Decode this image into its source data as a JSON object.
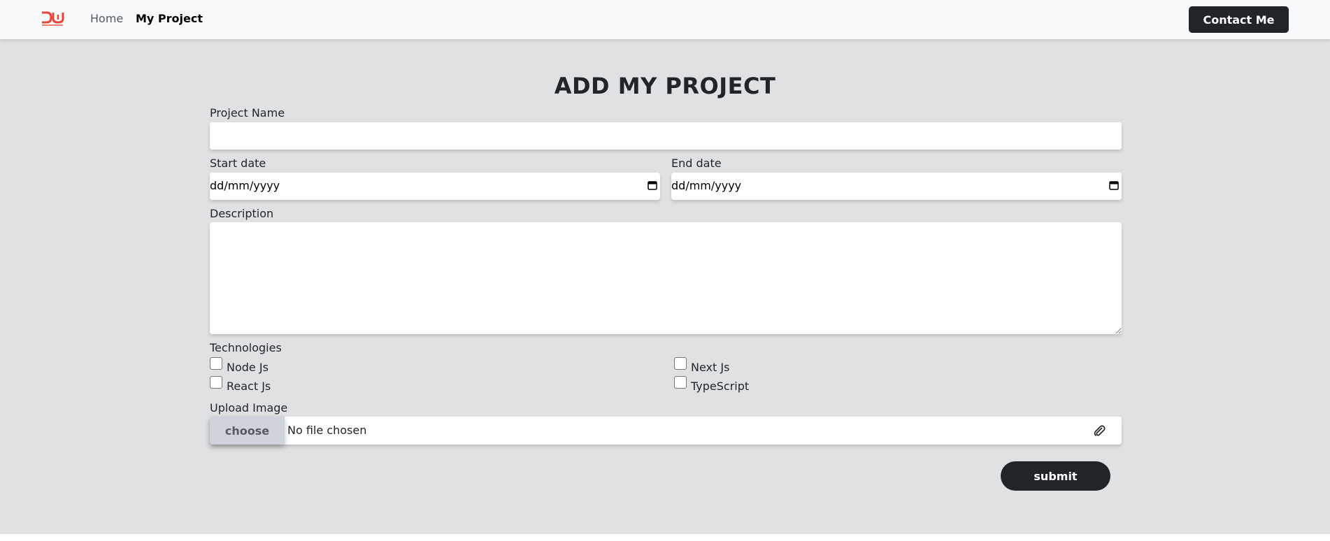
{
  "navbar": {
    "home_label": "Home",
    "project_label": "My Project",
    "contact_label": "Contact Me",
    "logo_icon": "dw-logo-icon",
    "logo_color": "#e8463a"
  },
  "form": {
    "title": "ADD MY PROJECT",
    "project_name_label": "Project Name",
    "project_name_value": "",
    "start_date_label": "Start date",
    "start_date_value": "dd/mm/yyyy",
    "end_date_label": "End date",
    "end_date_value": "dd/mm/yyyy",
    "description_label": "Description",
    "description_value": "",
    "technologies_label": "Technologies",
    "technologies": [
      {
        "label": "Node Js",
        "checked": false
      },
      {
        "label": "Next Js",
        "checked": false
      },
      {
        "label": "React Js",
        "checked": false
      },
      {
        "label": "TypeScript",
        "checked": false
      }
    ],
    "upload_label": "Upload Image",
    "choose_label": "choose",
    "file_status": "No file chosen",
    "submit_label": "submit"
  },
  "colors": {
    "background": "#e0e1e3",
    "navbar": "#f8f9fa",
    "dark": "#212529",
    "accent": "#e8463a"
  }
}
